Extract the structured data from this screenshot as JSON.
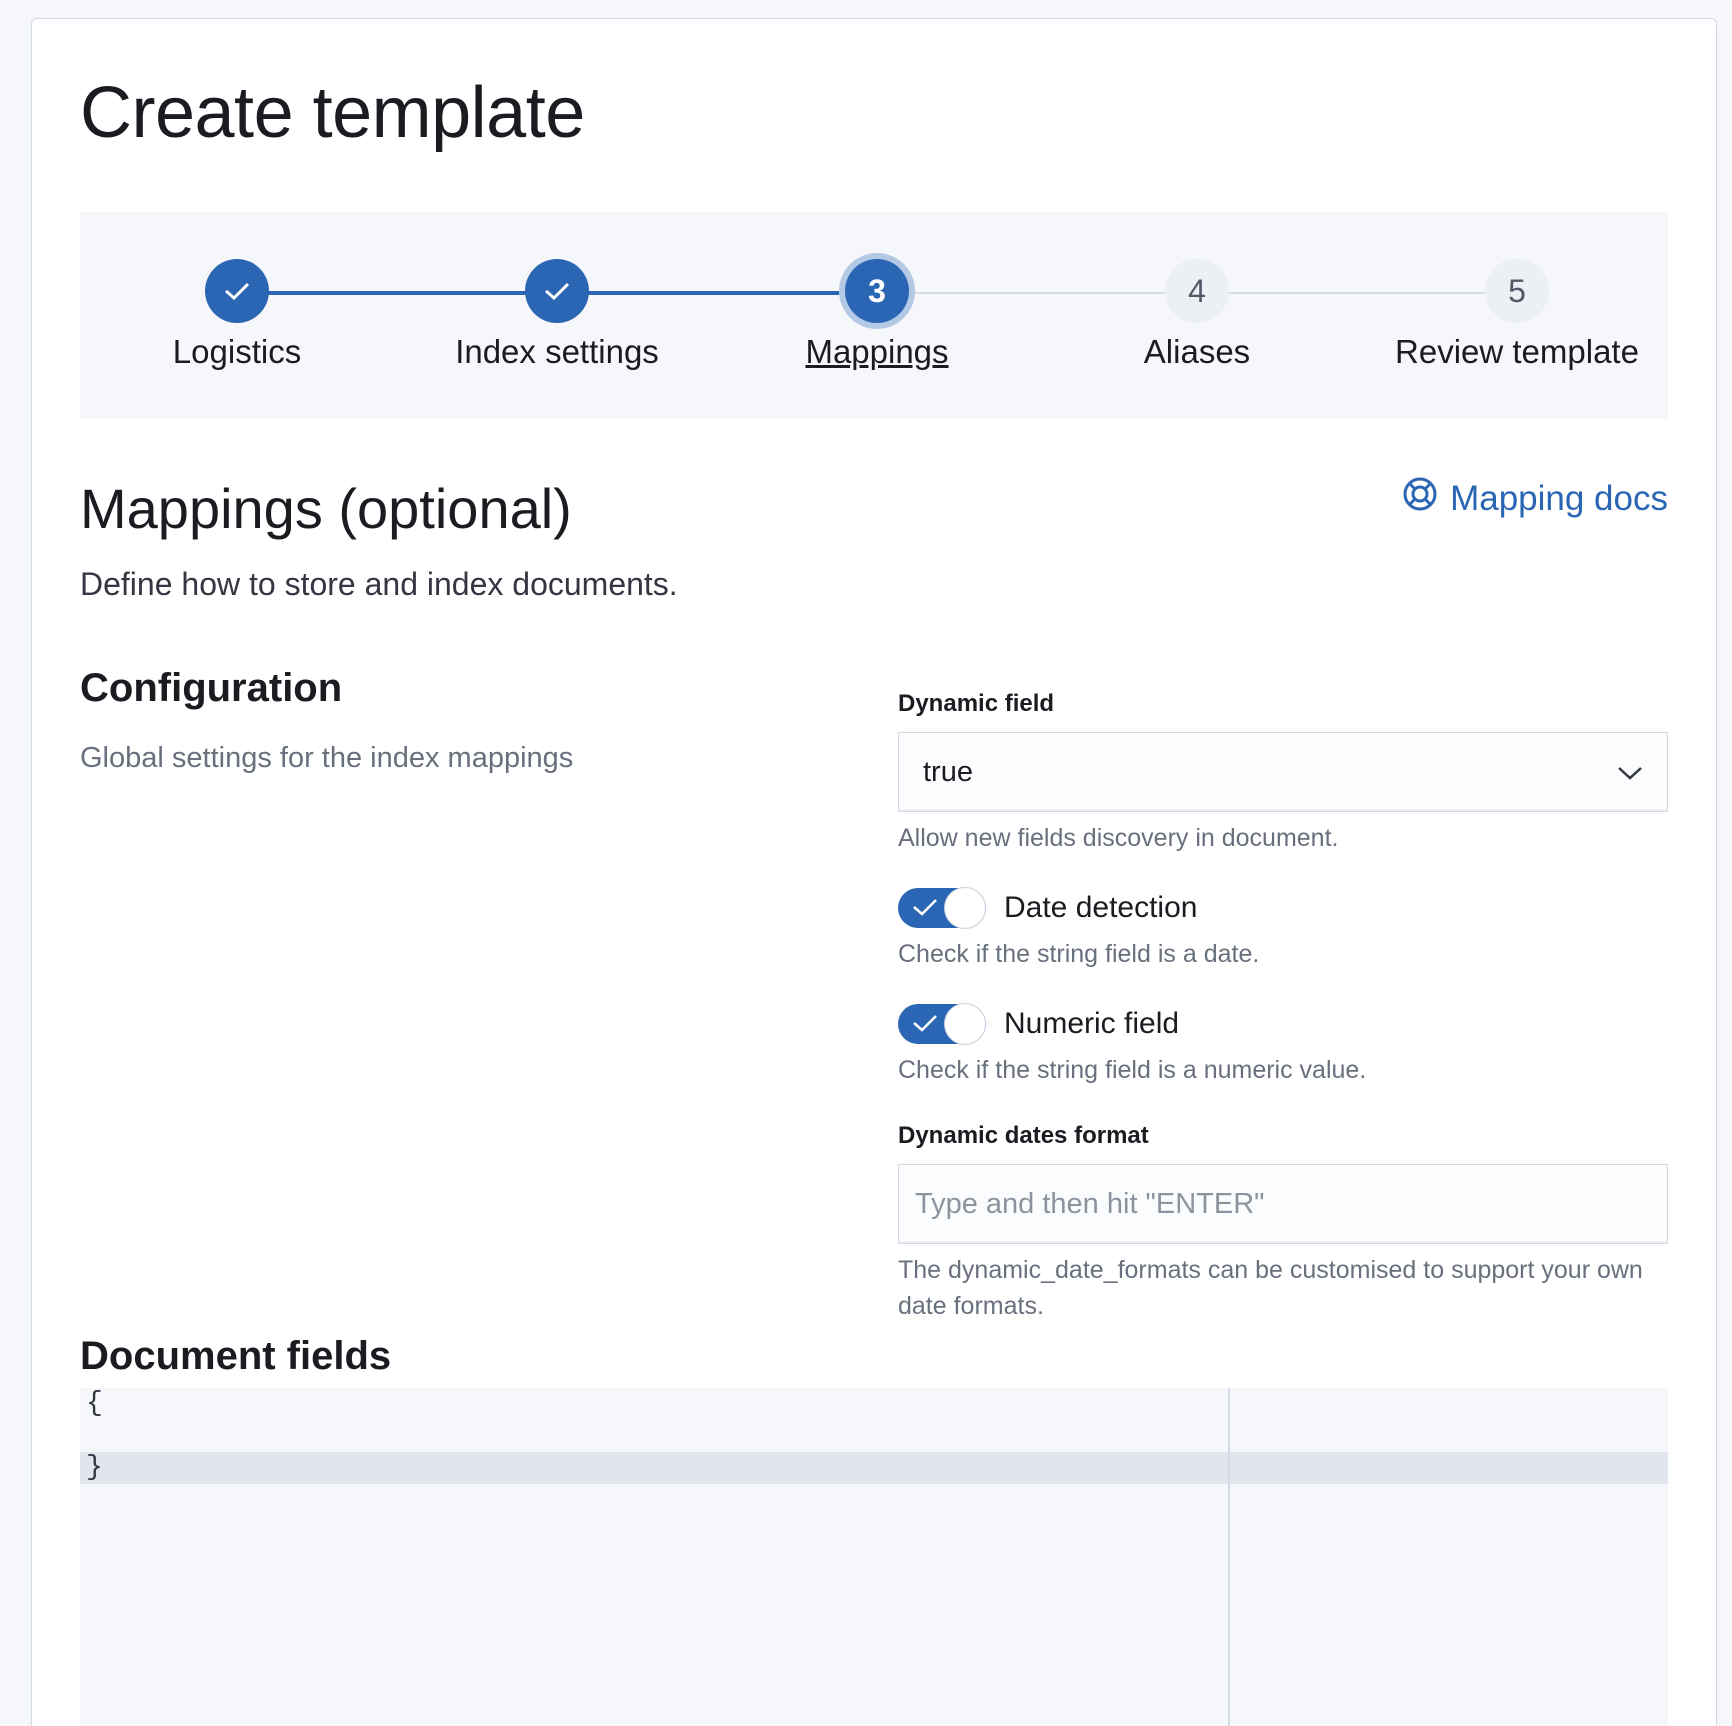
{
  "page": {
    "title": "Create template"
  },
  "stepper": {
    "steps": [
      {
        "label": "Logistics",
        "number": "1",
        "state": "complete"
      },
      {
        "label": "Index settings",
        "number": "2",
        "state": "complete"
      },
      {
        "label": "Mappings",
        "number": "3",
        "state": "current"
      },
      {
        "label": "Aliases",
        "number": "4",
        "state": "incomplete"
      },
      {
        "label": "Review template",
        "number": "5",
        "state": "incomplete"
      }
    ]
  },
  "section": {
    "title": "Mappings (optional)",
    "description": "Define how to store and index documents.",
    "docs_link": "Mapping docs"
  },
  "configuration": {
    "title": "Configuration",
    "description": "Global settings for the index mappings",
    "dynamic_field": {
      "label": "Dynamic field",
      "value": "true",
      "help": "Allow new fields discovery in document."
    },
    "date_detection": {
      "label": "Date detection",
      "checked": true,
      "help": "Check if the string field is a date."
    },
    "numeric_field": {
      "label": "Numeric field",
      "checked": true,
      "help": "Check if the string field is a numeric value."
    },
    "dynamic_dates_format": {
      "label": "Dynamic dates format",
      "placeholder": "Type and then hit \"ENTER\"",
      "help": "The dynamic_date_formats can be customised to support your own date formats."
    }
  },
  "document_fields": {
    "title": "Document fields",
    "editor_lines": [
      "{",
      "",
      "}"
    ]
  },
  "colors": {
    "primary": "#2a66b3",
    "border": "#d3dae6",
    "subdued_text": "#69707d"
  }
}
